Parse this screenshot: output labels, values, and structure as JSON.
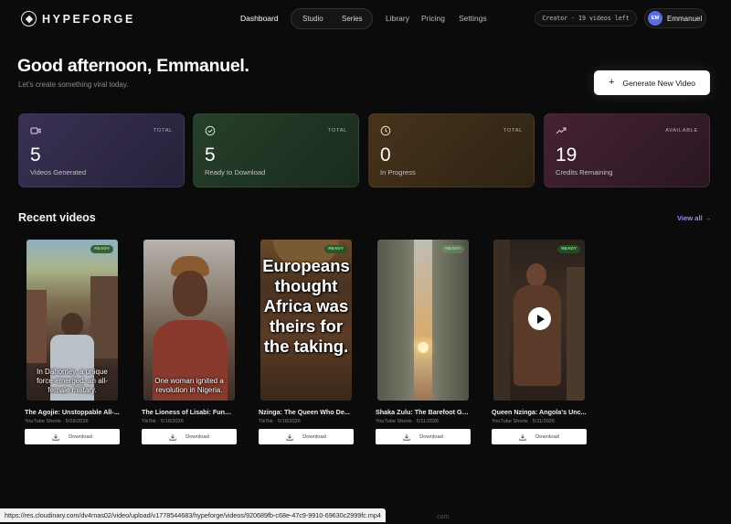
{
  "brand": {
    "name": "HYPEFORGE",
    "logo_icon": "diamond-in-circle-icon"
  },
  "nav": {
    "links": [
      "Dashboard",
      "Library",
      "Pricing",
      "Settings"
    ],
    "pill_items": [
      "Studio",
      "Series"
    ],
    "plan_badge": "Creator · 19 videos left",
    "user": {
      "initials": "EM",
      "name": "Emmanuel"
    }
  },
  "hero": {
    "greeting": "Good afternoon, Emmanuel.",
    "subtitle": "Let's create something viral today.",
    "generate_button": "Generate New Video"
  },
  "stats": [
    {
      "value": "5",
      "label": "Videos Generated",
      "tag": "TOTAL",
      "icon": "video-camera-icon"
    },
    {
      "value": "5",
      "label": "Ready to Download",
      "tag": "TOTAL",
      "icon": "check-circle-icon"
    },
    {
      "value": "0",
      "label": "In Progress",
      "tag": "TOTAL",
      "icon": "clock-icon"
    },
    {
      "value": "19",
      "label": "Credits Remaining",
      "tag": "AVAILABLE",
      "icon": "trending-up-icon"
    }
  ],
  "recent": {
    "title": "Recent videos",
    "view_all": "View all →",
    "download_label": "Download",
    "ready_label": "READY",
    "videos": [
      {
        "title": "The Agojie: Unstoppable All-...",
        "meta": "YouTube Shorts · 5/16/2026",
        "caption": "In Dahomey, a unique force emerged, an all-female military."
      },
      {
        "title": "The Lioness of Lisabi: Funmi...",
        "meta": "TikTok · 5/16/2026",
        "caption": "One woman ignited a revolution in Nigeria."
      },
      {
        "title": "Nzinga: The Queen Who De...",
        "meta": "TikTok · 5/16/2026",
        "caption": "Europeans thought Africa was theirs for the taking."
      },
      {
        "title": "Shaka Zulu: The Barefoot Ge...",
        "meta": "YouTube Shorts · 5/11/2026",
        "caption": ""
      },
      {
        "title": "Queen Nzinga: Angola's Unc...",
        "meta": "YouTube Shorts · 5/11/2026",
        "caption": ""
      }
    ]
  },
  "status_bar": {
    "url": "https://res.cloudinary.com/dv4rnas02/video/upload/v1778544683/hypeforge/videos/920689fb-c68e-47c9-9910-69630c2999fc.mp4",
    "tail": "com"
  },
  "colors": {
    "accent": "#9b8cf0",
    "ready": "#8fe08f",
    "avatar": "#5b6de0"
  }
}
